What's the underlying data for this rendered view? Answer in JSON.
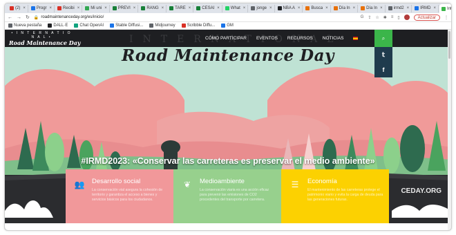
{
  "browser": {
    "tabs": [
      {
        "label": "(2)",
        "color": "#d93025"
      },
      {
        "label": "Progr",
        "color": "#1a73e8"
      },
      {
        "label": "Recibi",
        "color": "#d93025"
      },
      {
        "label": "Mi uni",
        "color": "#34a853"
      },
      {
        "label": "PREVI",
        "color": "#188038"
      },
      {
        "label": "RANG",
        "color": "#188038"
      },
      {
        "label": "TARE",
        "color": "#188038"
      },
      {
        "label": "CESAI",
        "color": "#188038"
      },
      {
        "label": "What",
        "color": "#25d366"
      },
      {
        "label": "jonge",
        "color": "#5f6368"
      },
      {
        "label": "NBA A",
        "color": "#202124"
      },
      {
        "label": "Busca",
        "color": "#e8710a"
      },
      {
        "label": "Día In",
        "color": "#e8710a"
      },
      {
        "label": "Día In",
        "color": "#e8710a"
      },
      {
        "label": "irmd2",
        "color": "#5f6368"
      },
      {
        "label": "IRMD",
        "color": "#1a73e8"
      },
      {
        "label": "Inte",
        "color": "#3bb54a"
      }
    ],
    "new_tab": "+",
    "url": "roadmaintenanceday.org/es/inicio/",
    "update_label": "Actualizar",
    "bookmarks": [
      {
        "label": "Nueva pestaña",
        "color": "#5f6368"
      },
      {
        "label": "DALL·E",
        "color": "#202124"
      },
      {
        "label": "Chat OpenAI",
        "color": "#10a37f"
      },
      {
        "label": "Stable Diffusi...",
        "color": "#1a73e8"
      },
      {
        "label": "Midjourney",
        "color": "#5f6368"
      },
      {
        "label": "Scribble Diffu...",
        "color": "#d93025"
      },
      {
        "label": "GM",
        "color": "#1a73e8"
      }
    ]
  },
  "site": {
    "logo_top": "• I N T E R N A T I O N A L •",
    "logo_main": "Road Maintenance Day",
    "ghost_text": "INTERNATIONAL",
    "nav": [
      "CÓMO PARTICIPAR",
      "EVENTOS",
      "RECURSOS",
      "NOTICIAS"
    ],
    "hero_title": "Road Maintenance Day",
    "campaign": "#IRMD2023: «Conservar las carreteras es preservar el medio ambiente»",
    "watermark": "CEDAY.ORG",
    "cards": [
      {
        "title": "Desarrollo social",
        "icon": "people-icon",
        "text": "La conservación vial asegura la cohesión de territorio y garantiza el acceso a bienes y servicios básicos para los ciudadanos.",
        "color": "#f1989a"
      },
      {
        "title": "Medioambiente",
        "icon": "leaf-icon",
        "text": "La conservación viaria es una acción eficaz para prevenir las emisiones de CO2 procedentes del transporte por carretera.",
        "color": "#97d08d"
      },
      {
        "title": "Economía",
        "icon": "database-icon",
        "text": "El mantenimiento de las carreteras protege el patrimonio viario y evita la carga de deuda para las generaciones futuras.",
        "color": "#fcd101"
      }
    ]
  }
}
